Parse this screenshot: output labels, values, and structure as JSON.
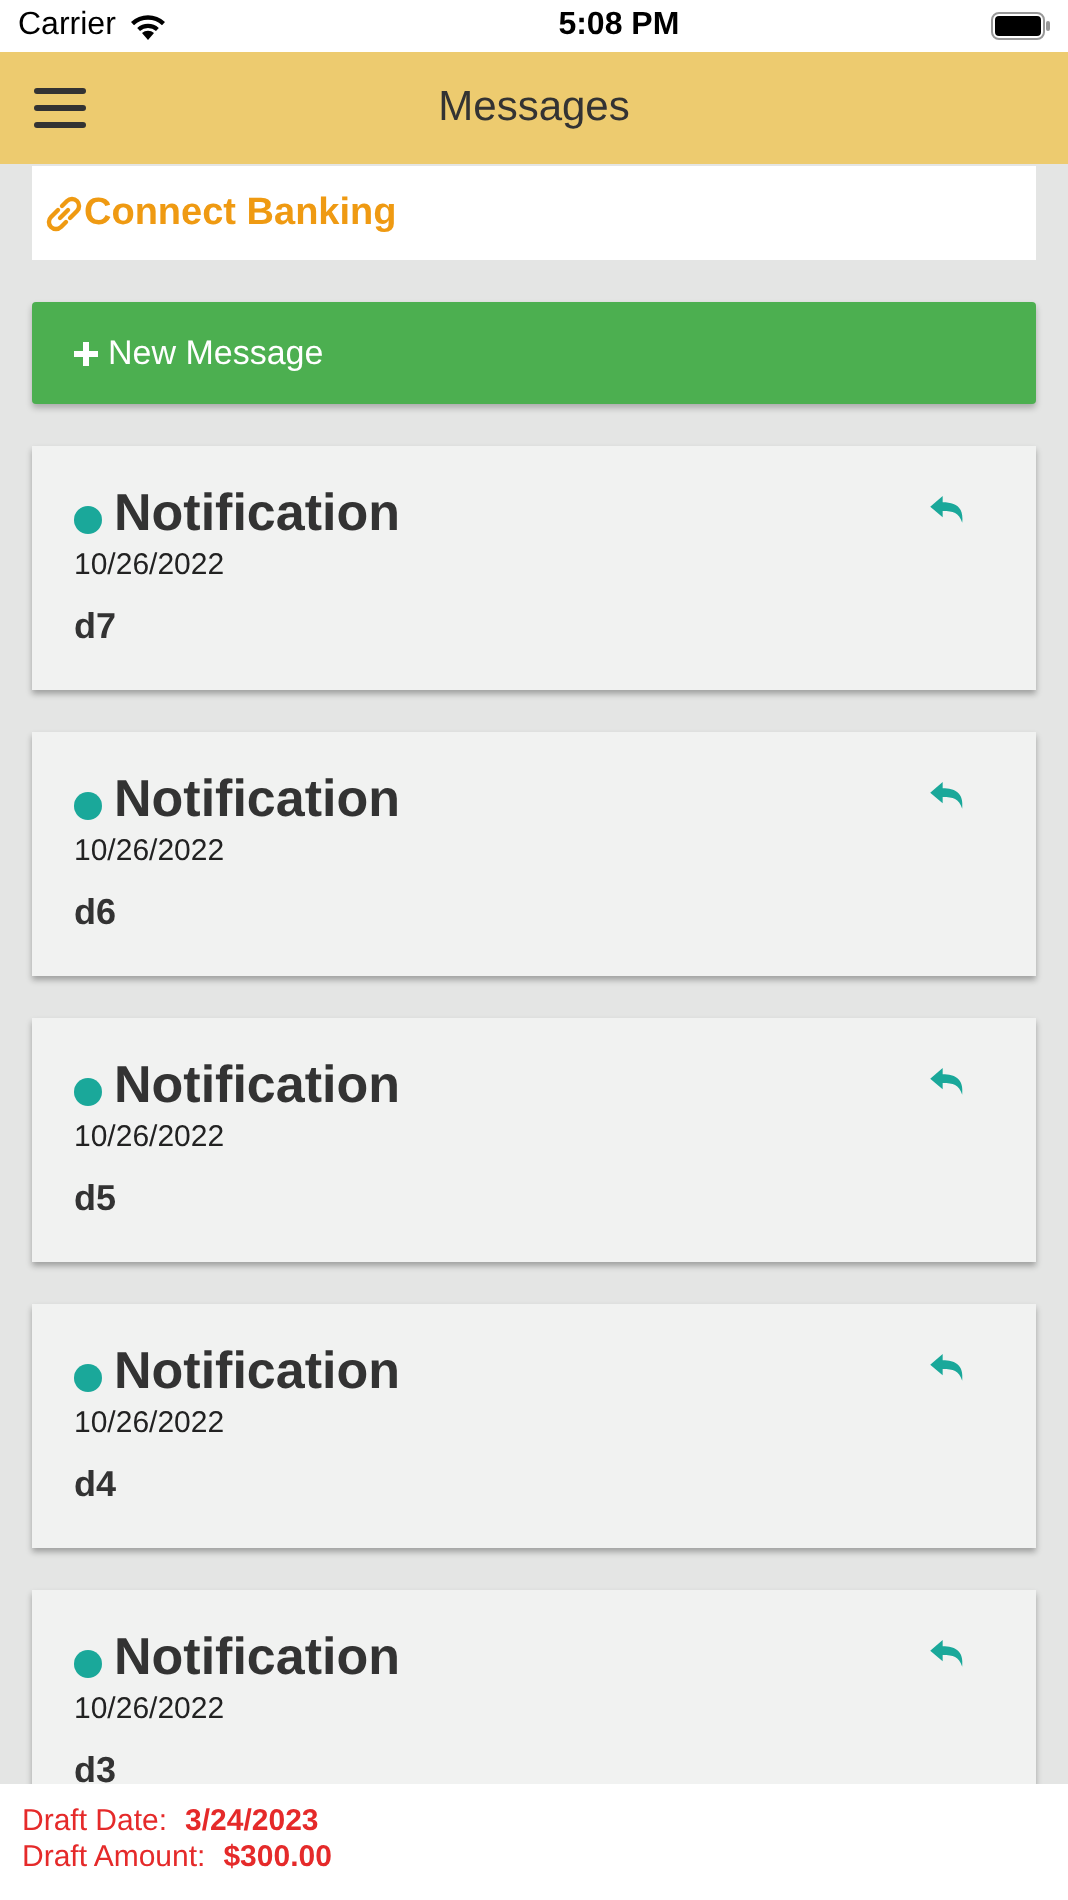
{
  "status_bar": {
    "carrier": "Carrier",
    "time": "5:08 PM"
  },
  "header": {
    "title": "Messages"
  },
  "connect_banking": {
    "label": "Connect Banking"
  },
  "new_message_button": {
    "label": "New Message"
  },
  "messages": [
    {
      "title": "Notification",
      "date": "10/26/2022",
      "body": "d7",
      "unread": true
    },
    {
      "title": "Notification",
      "date": "10/26/2022",
      "body": "d6",
      "unread": true
    },
    {
      "title": "Notification",
      "date": "10/26/2022",
      "body": "d5",
      "unread": true
    },
    {
      "title": "Notification",
      "date": "10/26/2022",
      "body": "d4",
      "unread": true
    },
    {
      "title": "Notification",
      "date": "10/26/2022",
      "body": "d3",
      "unread": true
    }
  ],
  "footer": [
    {
      "label": "Draft Date:",
      "value": "3/24/2023"
    },
    {
      "label": "Draft Amount:",
      "value": "$300.00"
    }
  ]
}
